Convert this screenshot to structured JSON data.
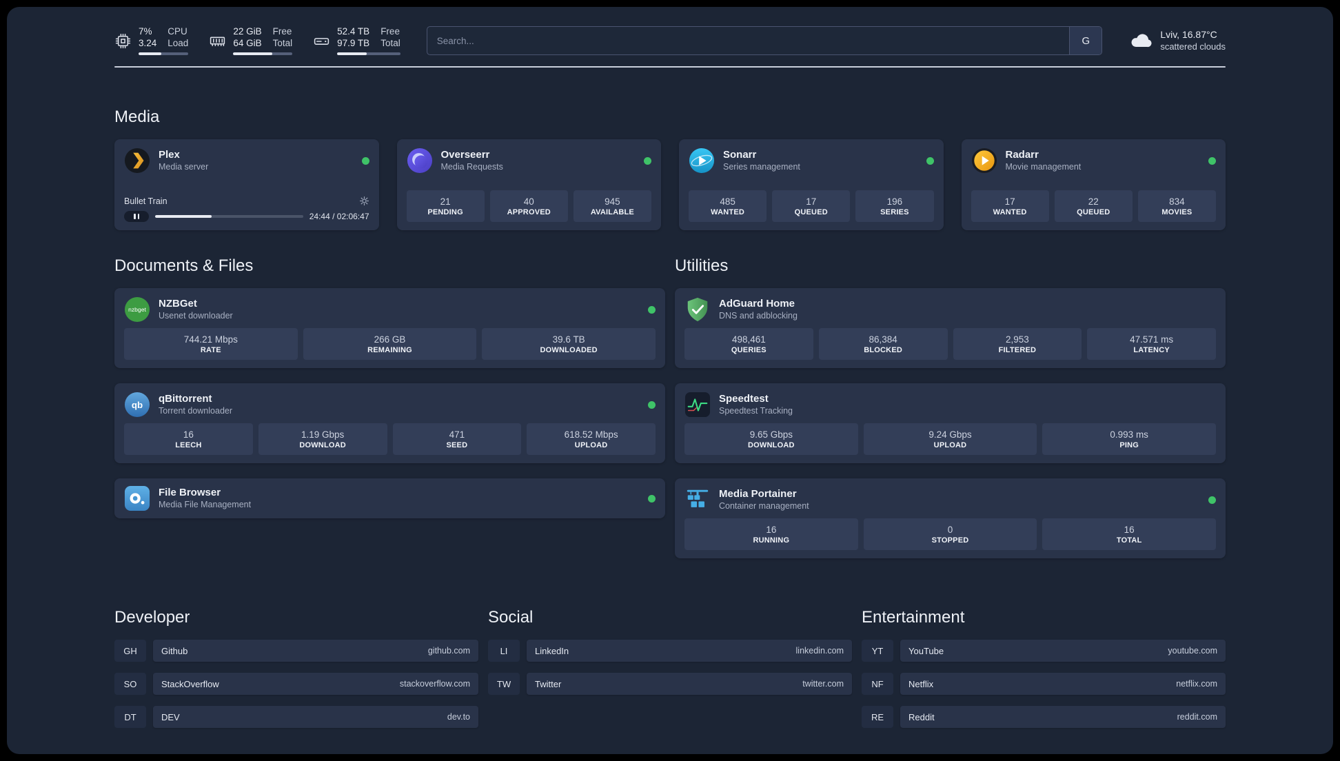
{
  "colors": {
    "background": "#1c2535",
    "card": "#293349",
    "stat_tile": "#333e58",
    "status_online": "#3fc368",
    "accent_green": "#3ddc84"
  },
  "topbar": {
    "cpu": {
      "percent_text": "7%",
      "load_value": "3.24",
      "label_line1": "CPU",
      "label_line2": "Load",
      "bar_percent": 45
    },
    "ram": {
      "free_value": "22 GiB",
      "total_value": "64 GiB",
      "label_line1": "Free",
      "label_line2": "Total",
      "bar_percent": 66
    },
    "disk": {
      "free_value": "52.4 TB",
      "total_value": "97.9 TB",
      "label_line1": "Free",
      "label_line2": "Total",
      "bar_percent": 47
    },
    "search": {
      "placeholder": "Search...",
      "button_label": "G"
    },
    "weather": {
      "location_temp": "Lviv, 16.87°C",
      "condition": "scattered clouds"
    }
  },
  "media": {
    "heading": "Media",
    "plex": {
      "name": "Plex",
      "subtitle": "Media server",
      "now_playing": "Bullet Train",
      "time": "24:44 / 02:06:47",
      "progress_percent": 38
    },
    "overseerr": {
      "name": "Overseerr",
      "subtitle": "Media Requests",
      "stats": [
        {
          "value": "21",
          "label": "PENDING"
        },
        {
          "value": "40",
          "label": "APPROVED"
        },
        {
          "value": "945",
          "label": "AVAILABLE"
        }
      ]
    },
    "sonarr": {
      "name": "Sonarr",
      "subtitle": "Series management",
      "stats": [
        {
          "value": "485",
          "label": "WANTED"
        },
        {
          "value": "17",
          "label": "QUEUED"
        },
        {
          "value": "196",
          "label": "SERIES"
        }
      ]
    },
    "radarr": {
      "name": "Radarr",
      "subtitle": "Movie management",
      "stats": [
        {
          "value": "17",
          "label": "WANTED"
        },
        {
          "value": "22",
          "label": "QUEUED"
        },
        {
          "value": "834",
          "label": "MOVIES"
        }
      ]
    }
  },
  "documents": {
    "heading": "Documents & Files",
    "nzbget": {
      "name": "NZBGet",
      "subtitle": "Usenet downloader",
      "icon_text": "nzbget",
      "stats": [
        {
          "value": "744.21 Mbps",
          "label": "RATE"
        },
        {
          "value": "266 GB",
          "label": "REMAINING"
        },
        {
          "value": "39.6 TB",
          "label": "DOWNLOADED"
        }
      ]
    },
    "qbittorrent": {
      "name": "qBittorrent",
      "subtitle": "Torrent downloader",
      "icon_text": "qb",
      "stats": [
        {
          "value": "16",
          "label": "LEECH"
        },
        {
          "value": "1.19 Gbps",
          "label": "DOWNLOAD"
        },
        {
          "value": "471",
          "label": "SEED"
        },
        {
          "value": "618.52 Mbps",
          "label": "UPLOAD"
        }
      ]
    },
    "filebrowser": {
      "name": "File Browser",
      "subtitle": "Media File Management"
    }
  },
  "utilities": {
    "heading": "Utilities",
    "adguard": {
      "name": "AdGuard Home",
      "subtitle": "DNS and adblocking",
      "stats": [
        {
          "value": "498,461",
          "label": "QUERIES"
        },
        {
          "value": "86,384",
          "label": "BLOCKED"
        },
        {
          "value": "2,953",
          "label": "FILTERED"
        },
        {
          "value": "47.571 ms",
          "label": "LATENCY"
        }
      ]
    },
    "speedtest": {
      "name": "Speedtest",
      "subtitle": "Speedtest Tracking",
      "stats": [
        {
          "value": "9.65 Gbps",
          "label": "DOWNLOAD"
        },
        {
          "value": "9.24 Gbps",
          "label": "UPLOAD"
        },
        {
          "value": "0.993 ms",
          "label": "PING"
        }
      ]
    },
    "portainer": {
      "name": "Media Portainer",
      "subtitle": "Container management",
      "stats": [
        {
          "value": "16",
          "label": "RUNNING"
        },
        {
          "value": "0",
          "label": "STOPPED"
        },
        {
          "value": "16",
          "label": "TOTAL"
        }
      ]
    }
  },
  "links": {
    "developer": {
      "heading": "Developer",
      "items": [
        {
          "abbr": "GH",
          "name": "Github",
          "url": "github.com"
        },
        {
          "abbr": "SO",
          "name": "StackOverflow",
          "url": "stackoverflow.com"
        },
        {
          "abbr": "DT",
          "name": "DEV",
          "url": "dev.to"
        }
      ]
    },
    "social": {
      "heading": "Social",
      "items": [
        {
          "abbr": "LI",
          "name": "LinkedIn",
          "url": "linkedin.com"
        },
        {
          "abbr": "TW",
          "name": "Twitter",
          "url": "twitter.com"
        }
      ]
    },
    "entertainment": {
      "heading": "Entertainment",
      "items": [
        {
          "abbr": "YT",
          "name": "YouTube",
          "url": "youtube.com"
        },
        {
          "abbr": "NF",
          "name": "Netflix",
          "url": "netflix.com"
        },
        {
          "abbr": "RE",
          "name": "Reddit",
          "url": "reddit.com"
        }
      ]
    }
  }
}
